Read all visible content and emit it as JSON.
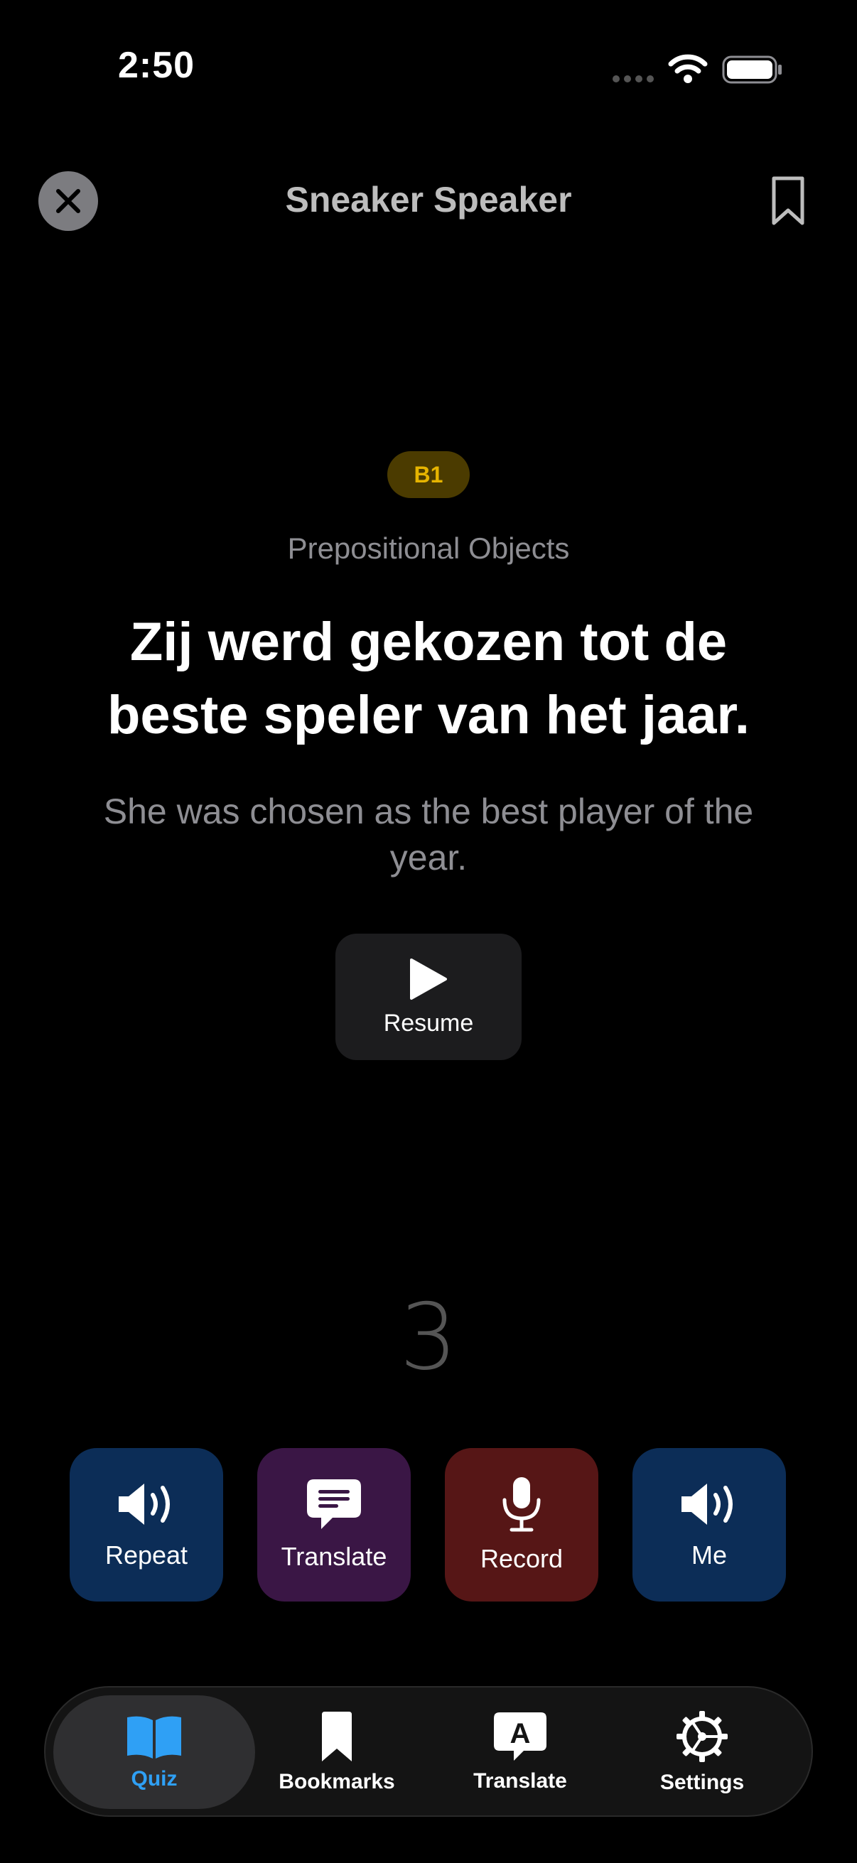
{
  "status_bar": {
    "time": "2:50"
  },
  "nav": {
    "title": "Sneaker Speaker"
  },
  "card": {
    "level": "B1",
    "topic": "Prepositional Objects",
    "sentence": "Zij werd gekozen tot de beste speler van het jaar.",
    "translation": "She was chosen as the best player of the year.",
    "resume_label": "Resume",
    "counter": "3"
  },
  "actions": [
    {
      "label": "Repeat",
      "icon": "speaker-icon"
    },
    {
      "label": "Translate",
      "icon": "chat-bubble-icon"
    },
    {
      "label": "Record",
      "icon": "microphone-icon"
    },
    {
      "label": "Me",
      "icon": "speaker-icon"
    }
  ],
  "tabs": [
    {
      "label": "Quiz",
      "icon": "book-icon",
      "active": true
    },
    {
      "label": "Bookmarks",
      "icon": "bookmark-icon",
      "active": false
    },
    {
      "label": "Translate",
      "icon": "translate-icon",
      "active": false
    },
    {
      "label": "Settings",
      "icon": "gear-icon",
      "active": false
    }
  ],
  "colors": {
    "background": "#000000",
    "accent": "#2fa0f5",
    "badge_bg": "#4b3b00",
    "badge_text": "#e6b400",
    "repeat_bg": "#0c2d57",
    "translate_bg": "#3a1645",
    "record_bg": "#561616"
  }
}
